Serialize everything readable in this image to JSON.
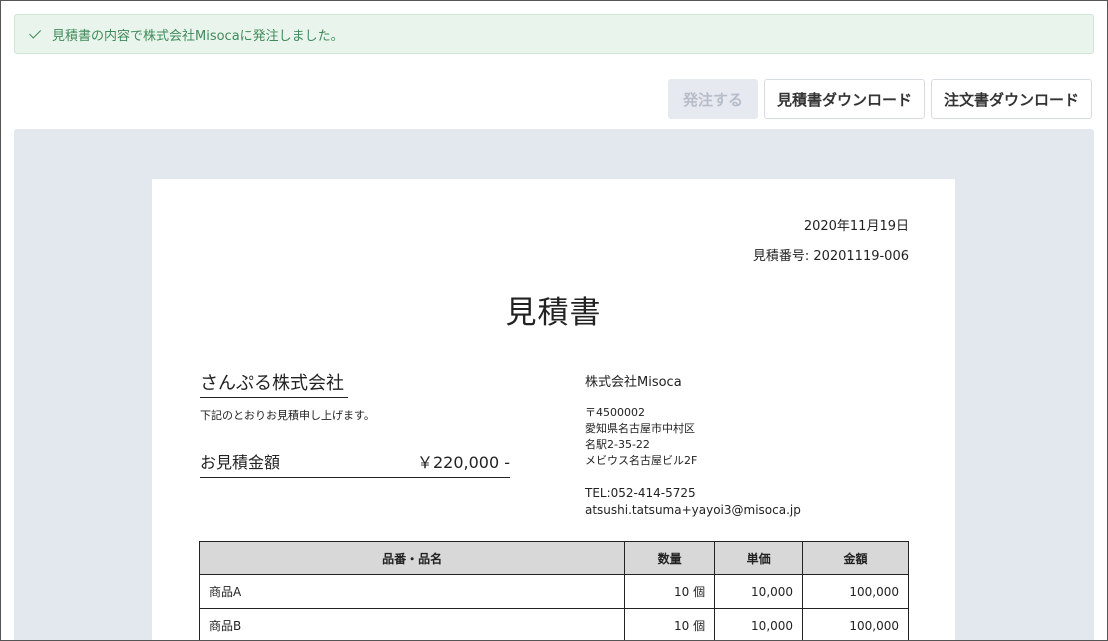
{
  "alert": {
    "message": "見積書の内容で株式会社Misocaに発注しました。"
  },
  "toolbar": {
    "order_label": "発注する",
    "download_estimate_label": "見積書ダウンロード",
    "download_order_label": "注文書ダウンロード"
  },
  "document": {
    "date": "2020年11月19日",
    "estimate_number": "見積番号: 20201119-006",
    "title": "見積書",
    "client_name": "さんぷる株式会社",
    "intro": "下記のとおりお見積申し上げます。",
    "total_label": "お見積金額",
    "total_value": "￥220,000 -",
    "issuer": {
      "name": "株式会社Misoca",
      "postal": "〒4500002",
      "address1": "愛知県名古屋市中村区",
      "address2": "名駅2-35-22",
      "address3": "メビウス名古屋ビル2F",
      "tel": "TEL:052-414-5725",
      "email": "atsushi.tatsuma+yayoi3@misoca.jp"
    },
    "table": {
      "headers": [
        "品番・品名",
        "数量",
        "単価",
        "金額"
      ],
      "rows": [
        [
          "商品A",
          "10 個",
          "10,000",
          "100,000"
        ],
        [
          "商品B",
          "10 個",
          "10,000",
          "100,000"
        ]
      ]
    }
  },
  "colors": {
    "alert_bg": "#e9f5ec",
    "alert_text": "#3f8a5a",
    "viewer_bg": "#e3e8ef",
    "table_header_bg": "#d8d8d8"
  }
}
